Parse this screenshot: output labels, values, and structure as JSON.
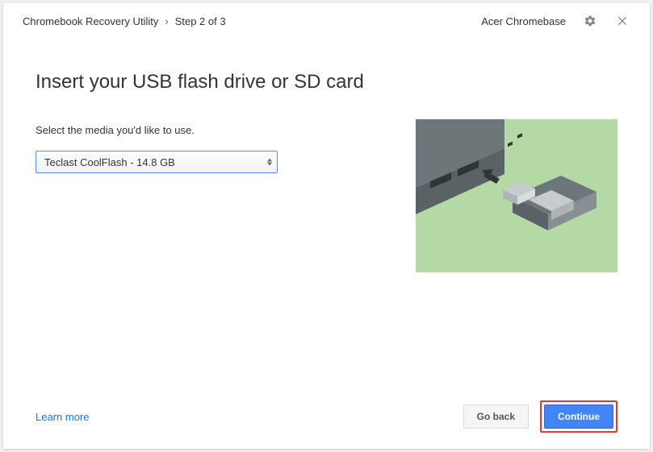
{
  "titlebar": {
    "app_name": "Chromebook Recovery Utility",
    "separator": "›",
    "step_label": "Step 2 of 3",
    "device_label": "Acer Chromebase"
  },
  "page": {
    "heading": "Insert your USB flash drive or SD card",
    "instruction": "Select the media you'd like to use.",
    "selected_media": "Teclast CoolFlash - 14.8 GB"
  },
  "footer": {
    "learn_more": "Learn more",
    "go_back": "Go back",
    "continue": "Continue"
  }
}
